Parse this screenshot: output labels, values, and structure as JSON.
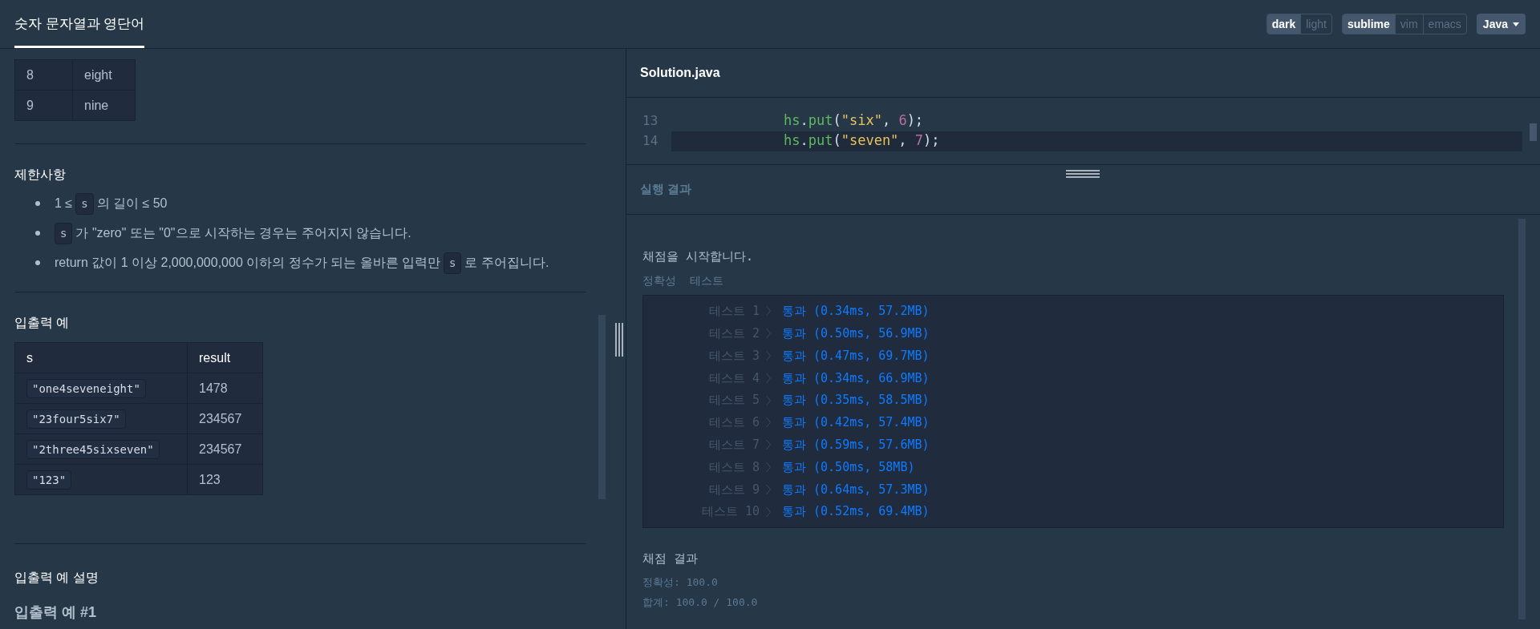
{
  "header": {
    "tab": {
      "label": "숫자 문자열과 영단어",
      "selected": true
    },
    "theme_toggle": [
      {
        "label": "dark",
        "selected": true
      },
      {
        "label": "light",
        "selected": false
      }
    ],
    "keymap_toggle": [
      {
        "label": "sublime",
        "selected": true
      },
      {
        "label": "vim",
        "selected": false
      },
      {
        "label": "emacs",
        "selected": false
      }
    ],
    "language": "Java"
  },
  "problem": {
    "word_table_rows": [
      [
        "8",
        "eight"
      ],
      [
        "9",
        "nine"
      ]
    ],
    "constraints": {
      "title": "제한사항",
      "items": [
        [
          {
            "kind": "text",
            "text": "1 ≤"
          },
          {
            "kind": "code",
            "text": "s"
          },
          {
            "kind": "text",
            "text": "의 길이 ≤ 50"
          }
        ],
        [
          {
            "kind": "code",
            "text": "s"
          },
          {
            "kind": "text",
            "text": "가 \"zero\" 또는 \"0\"으로 시작하는 경우는 주어지지 않습니다."
          }
        ],
        [
          {
            "kind": "text",
            "text": "return 값이 1 이상 2,000,000,000 이하의 정수가 되는 올바른 입력만"
          },
          {
            "kind": "code",
            "text": "s"
          },
          {
            "kind": "text",
            "text": "로 주어집니다."
          }
        ]
      ]
    },
    "examples": {
      "title": "입출력 예",
      "columns": [
        "s",
        "result"
      ],
      "rows": [
        [
          "\"one4seveneight\"",
          "1478"
        ],
        [
          "\"23four5six7\"",
          "234567"
        ],
        [
          "\"2three45sixseven\"",
          "234567"
        ],
        [
          "\"123\"",
          "123"
        ]
      ]
    },
    "explanation": {
      "title": "입출력 예 설명",
      "subtitle": "입출력 예 #1"
    }
  },
  "editor": {
    "filename": "Solution.java",
    "lines": [
      {
        "number": "13",
        "current": false,
        "tokens": [
          {
            "kind": "ident",
            "text": "hs"
          },
          {
            "kind": "plain",
            "text": "."
          },
          {
            "kind": "ident",
            "text": "put"
          },
          {
            "kind": "plain",
            "text": "("
          },
          {
            "kind": "string",
            "text": "\"six\""
          },
          {
            "kind": "plain",
            "text": ", "
          },
          {
            "kind": "number",
            "text": "6"
          },
          {
            "kind": "plain",
            "text": ");"
          }
        ]
      },
      {
        "number": "14",
        "current": true,
        "tokens": [
          {
            "kind": "ident",
            "text": "hs"
          },
          {
            "kind": "plain",
            "text": "."
          },
          {
            "kind": "ident",
            "text": "put"
          },
          {
            "kind": "plain",
            "text": "("
          },
          {
            "kind": "string",
            "text": "\"seven\""
          },
          {
            "kind": "plain",
            "text": ", "
          },
          {
            "kind": "number",
            "text": "7"
          },
          {
            "kind": "plain",
            "text": ");"
          }
        ]
      }
    ]
  },
  "result": {
    "title": "실행 결과",
    "start": "채점을 시작합니다.",
    "group": "정확성  테스트",
    "tests": [
      {
        "label": "테스트 1",
        "passed": true,
        "result": "통과 (0.34ms, 57.2MB)"
      },
      {
        "label": "테스트 2",
        "passed": true,
        "result": "통과 (0.50ms, 56.9MB)"
      },
      {
        "label": "테스트 3",
        "passed": true,
        "result": "통과 (0.47ms, 69.7MB)"
      },
      {
        "label": "테스트 4",
        "passed": true,
        "result": "통과 (0.34ms, 66.9MB)"
      },
      {
        "label": "테스트 5",
        "passed": true,
        "result": "통과 (0.35ms, 58.5MB)"
      },
      {
        "label": "테스트 6",
        "passed": true,
        "result": "통과 (0.42ms, 57.4MB)"
      },
      {
        "label": "테스트 7",
        "passed": true,
        "result": "통과 (0.59ms, 57.6MB)"
      },
      {
        "label": "테스트 8",
        "passed": true,
        "result": "통과 (0.50ms, 58MB)"
      },
      {
        "label": "테스트 9",
        "passed": true,
        "result": "통과 (0.64ms, 57.3MB)"
      },
      {
        "label": "테스트 10",
        "passed": true,
        "result": "통과 (0.52ms, 69.4MB)"
      }
    ],
    "summary_title": "채점 결과",
    "accuracy": "정확성: 100.0",
    "total": "합계: 100.0 / 100.0"
  }
}
